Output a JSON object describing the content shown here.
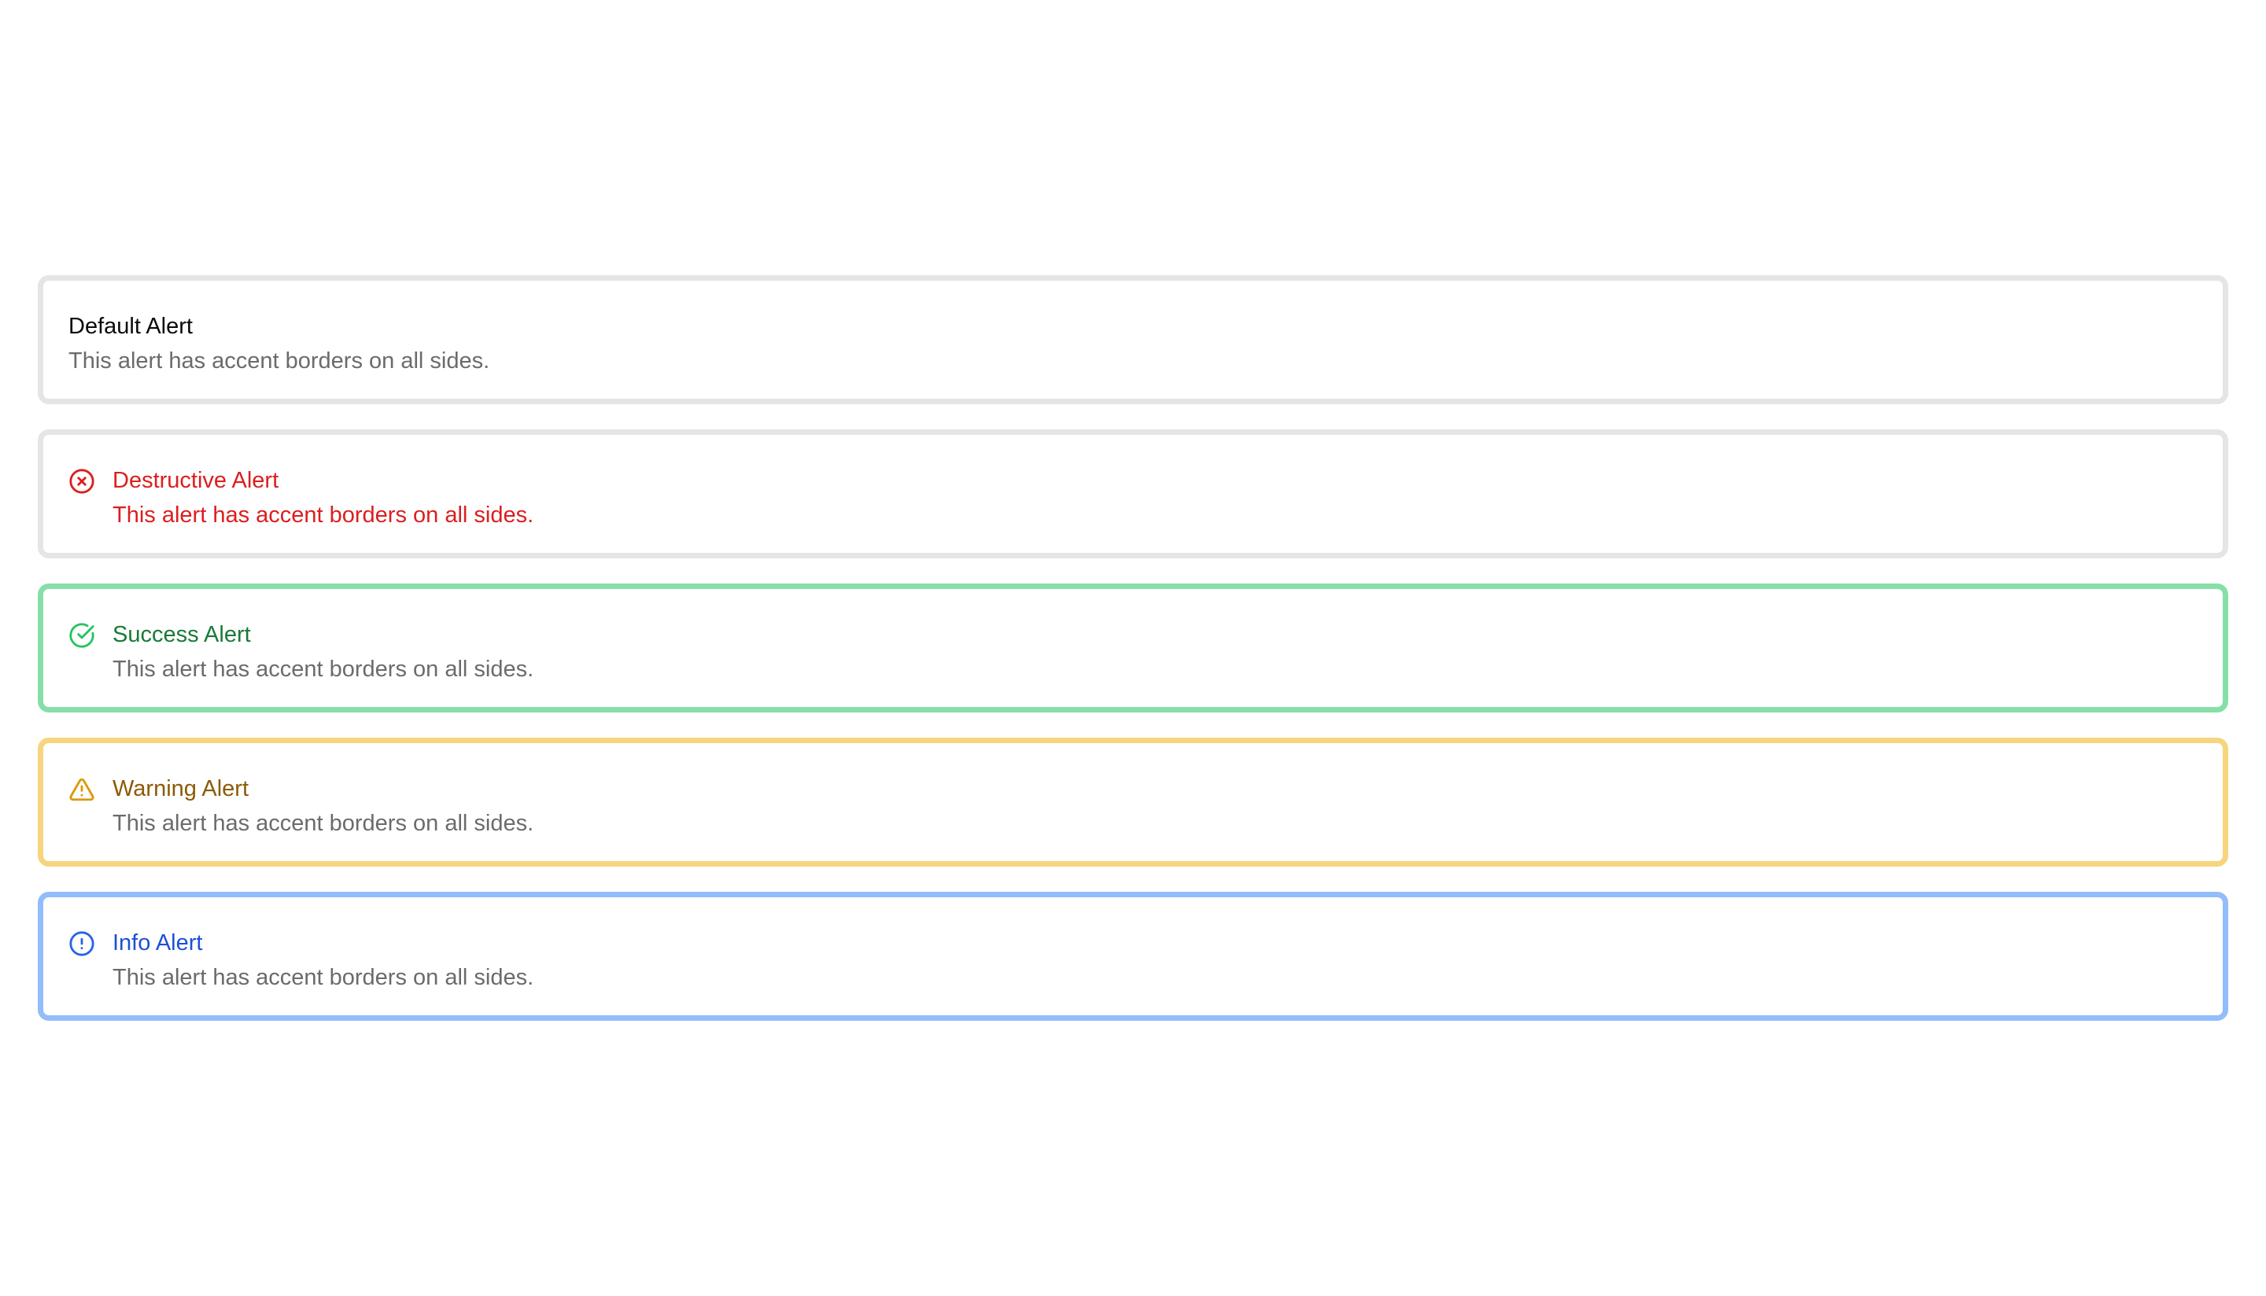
{
  "alerts": {
    "default": {
      "title": "Default Alert",
      "description": "This alert has accent borders on all sides.",
      "border_color": "#e5e5e5"
    },
    "destructive": {
      "title": "Destructive Alert",
      "description": "This alert has accent borders on all sides.",
      "icon": "circle-x-icon",
      "accent_color": "#dc1e1e",
      "border_color": "#e5e5e5"
    },
    "success": {
      "title": "Success Alert",
      "description": "This alert has accent borders on all sides.",
      "icon": "circle-check-icon",
      "accent_color": "#22c55e",
      "title_color": "#1a7a37",
      "border_color": "#86dfa6"
    },
    "warning": {
      "title": "Warning Alert",
      "description": "This alert has accent borders on all sides.",
      "icon": "triangle-alert-icon",
      "accent_color": "#d99a06",
      "title_color": "#8c5a06",
      "border_color": "#f6d57e"
    },
    "info": {
      "title": "Info Alert",
      "description": "This alert has accent borders on all sides.",
      "icon": "circle-info-icon",
      "accent_color": "#2563eb",
      "title_color": "#1d4fd8",
      "border_color": "#93bdfa"
    }
  }
}
